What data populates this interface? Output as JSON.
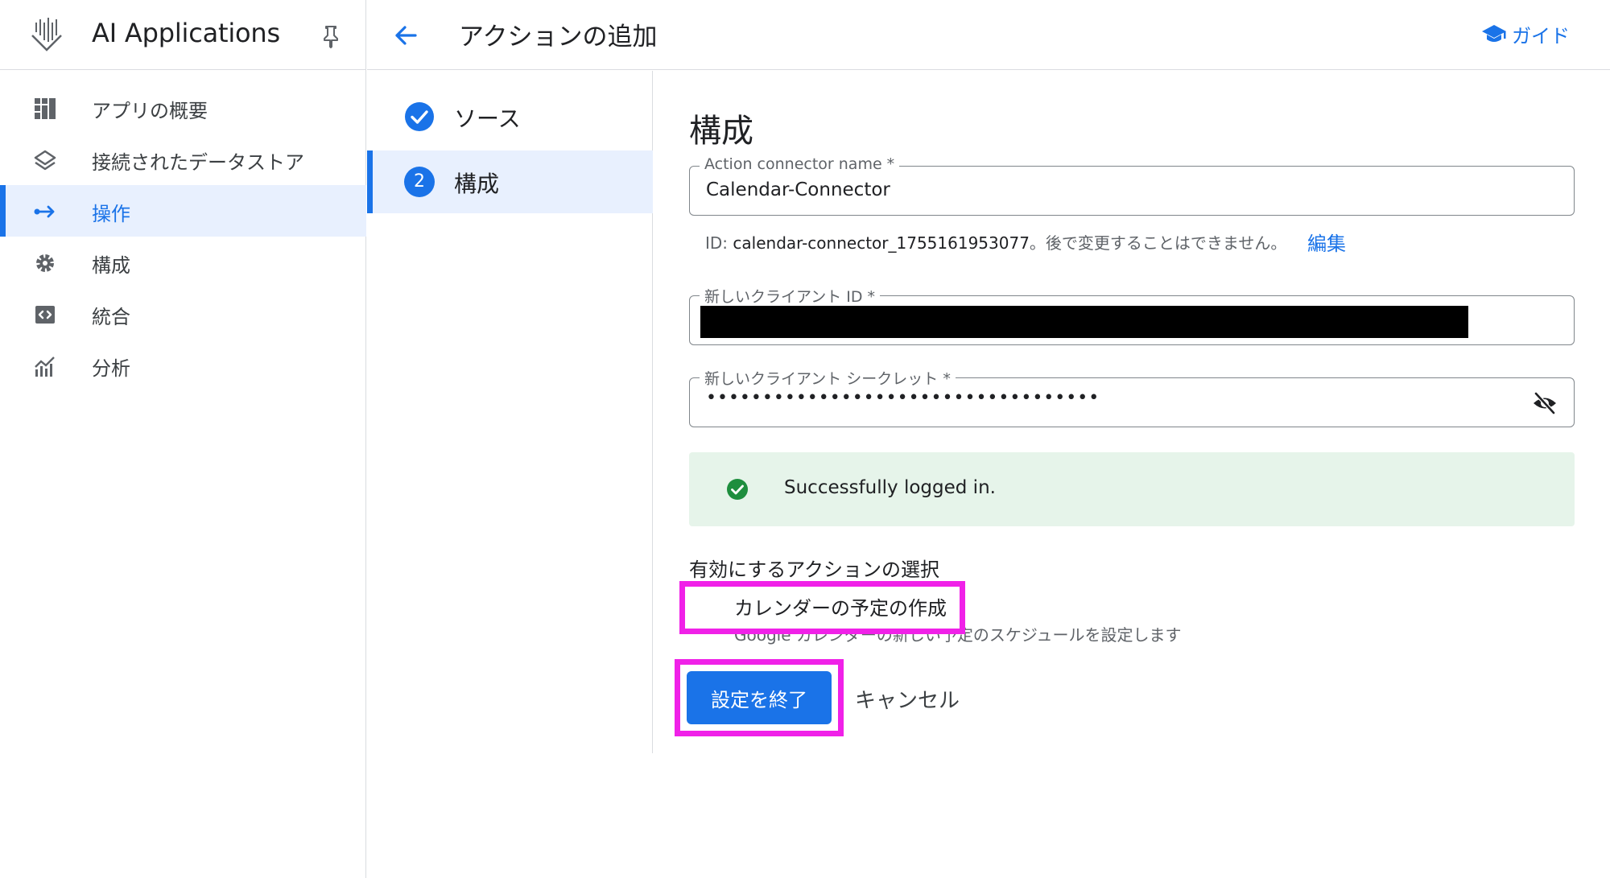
{
  "app": {
    "title": "AI Applications",
    "icons": {
      "logo": "ai-applications-logo",
      "pin": "pin-icon"
    }
  },
  "sidebar": {
    "items": [
      {
        "label": "アプリの概要",
        "icon": "dashboard-icon",
        "active": false
      },
      {
        "label": "接続されたデータストア",
        "icon": "layers-icon",
        "active": false
      },
      {
        "label": "操作",
        "icon": "actions-arrow-icon",
        "active": true
      },
      {
        "label": "構成",
        "icon": "gear-icon",
        "active": false
      },
      {
        "label": "統合",
        "icon": "code-icon",
        "active": false
      },
      {
        "label": "分析",
        "icon": "analytics-icon",
        "active": false
      }
    ]
  },
  "header": {
    "back_icon": "arrow-back-icon",
    "title": "アクションの追加",
    "guide_label": "ガイド",
    "guide_icon": "school-icon"
  },
  "stepper": {
    "steps": [
      {
        "label": "ソース",
        "state": "completed",
        "icon": "check-circle-icon"
      },
      {
        "label": "構成",
        "state": "active",
        "number": "2"
      }
    ]
  },
  "form": {
    "section_title": "構成",
    "connector_name": {
      "label": "Action connector name *",
      "value": "Calendar-Connector"
    },
    "id_line": {
      "prefix": "ID: ",
      "id_value": "calendar-connector_1755161953077",
      "suffix": "。後で変更することはできません。"
    },
    "edit_link": "編集",
    "client_id": {
      "label": "新しいクライアント ID *",
      "value_redacted": true
    },
    "client_secret": {
      "label": "新しいクライアント シークレット *",
      "value": "•••••••••••••••••••••••••••••••••••",
      "toggle_icon": "visibility-off-icon"
    },
    "success": {
      "text": "Successfully logged in.",
      "icon": "check-circle-green-icon"
    },
    "actions_title": "有効にするアクションの選択",
    "action_checkbox": {
      "label": "カレンダーの予定の作成",
      "checked": true,
      "description": "Google カレンダーの新しい予定のスケジュールを設定します"
    },
    "finish_button": "設定を終了",
    "cancel_button": "キャンセル"
  },
  "colors": {
    "accent": "#1a73e8",
    "highlight": "#f021e8",
    "success_bg": "#e6f4ea",
    "success_icon": "#1e8e3e",
    "active_bg": "#e8f0fe"
  }
}
